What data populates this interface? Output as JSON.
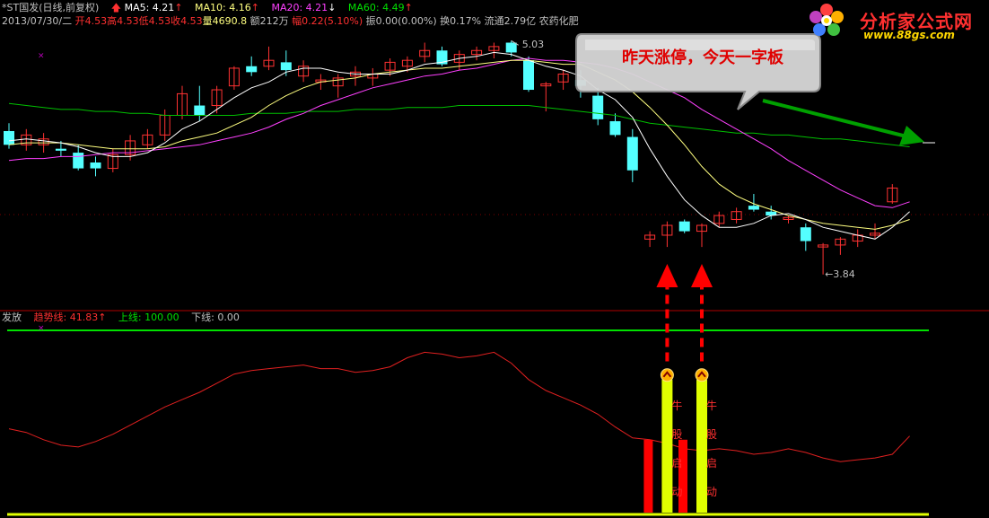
{
  "header": {
    "stock": "*ST国发(日线,前复权)",
    "ma5_label": "MA5: 4.21",
    "ma10_label": "MA10: 4.16",
    "ma20_label": "MA20: 4.21",
    "ma60_label": "MA60: 4.49",
    "date": "2013/07/30/二",
    "open": "开4.53",
    "high": "高4.53",
    "low": "低4.53",
    "close": "收4.53",
    "volume": "量4690.8",
    "amount": "额212万",
    "change": "幅0.22(5.10%)",
    "amplitude": "振0.00(0.00%)",
    "turnover": "换0.17%",
    "float": "流通2.79亿",
    "sector": "农药化肥"
  },
  "price_marks": {
    "high": "5.03",
    "low": "←3.84"
  },
  "callout": "昨天涨停，今天一字板",
  "logo": {
    "name": "分析家公式网",
    "url": "www.88gs.com"
  },
  "indicator": {
    "name": "发放",
    "trend_label": "趋势线: 41.83",
    "upper_label": "上线: 100.00",
    "lower_label": "下线: 0.00",
    "signal_text": [
      "牛",
      "股",
      "启",
      "动"
    ]
  },
  "colors": {
    "up": "#ff3232",
    "down": "#54ffff",
    "ma5": "#ffffff",
    "ma10": "#ffff80",
    "ma20": "#ff40ff",
    "ma60": "#00c000",
    "trend": "#e02020",
    "upper": "#00e000",
    "signal": "#e0ff00",
    "arrow": "#ff0000",
    "callout_arrow": "#00a000"
  },
  "chart_data": {
    "type": "candlestick",
    "ohlc": [
      [
        4.57,
        4.61,
        4.48,
        4.5
      ],
      [
        4.5,
        4.58,
        4.47,
        4.55
      ],
      [
        4.5,
        4.56,
        4.46,
        4.53
      ],
      [
        4.48,
        4.52,
        4.44,
        4.47
      ],
      [
        4.46,
        4.5,
        4.37,
        4.38
      ],
      [
        4.41,
        4.44,
        4.34,
        4.38
      ],
      [
        4.38,
        4.48,
        4.36,
        4.45
      ],
      [
        4.45,
        4.55,
        4.42,
        4.52
      ],
      [
        4.5,
        4.58,
        4.48,
        4.55
      ],
      [
        4.55,
        4.68,
        4.52,
        4.65
      ],
      [
        4.65,
        4.8,
        4.63,
        4.76
      ],
      [
        4.7,
        4.8,
        4.62,
        4.65
      ],
      [
        4.7,
        4.8,
        4.66,
        4.78
      ],
      [
        4.8,
        4.9,
        4.78,
        4.89
      ],
      [
        4.9,
        4.95,
        4.85,
        4.87
      ],
      [
        4.9,
        5.0,
        4.88,
        4.93
      ],
      [
        4.92,
        4.98,
        4.85,
        4.88
      ],
      [
        4.85,
        4.93,
        4.82,
        4.9
      ],
      [
        4.82,
        4.86,
        4.78,
        4.83
      ],
      [
        4.8,
        4.86,
        4.74,
        4.84
      ],
      [
        4.85,
        4.9,
        4.8,
        4.87
      ],
      [
        4.84,
        4.89,
        4.8,
        4.86
      ],
      [
        4.88,
        4.94,
        4.85,
        4.92
      ],
      [
        4.9,
        4.95,
        4.87,
        4.93
      ],
      [
        4.95,
        5.02,
        4.92,
        4.98
      ],
      [
        4.98,
        5.0,
        4.9,
        4.91
      ],
      [
        4.92,
        4.98,
        4.88,
        4.96
      ],
      [
        4.96,
        5.0,
        4.93,
        4.98
      ],
      [
        4.98,
        5.02,
        4.94,
        5.0
      ],
      [
        5.02,
        5.03,
        4.95,
        4.97
      ],
      [
        4.93,
        4.95,
        4.77,
        4.78
      ],
      [
        4.8,
        4.82,
        4.67,
        4.81
      ],
      [
        4.82,
        4.88,
        4.78,
        4.86
      ],
      [
        4.83,
        4.88,
        4.74,
        4.8
      ],
      [
        4.75,
        4.79,
        4.6,
        4.63
      ],
      [
        4.62,
        4.66,
        4.54,
        4.55
      ],
      [
        4.54,
        4.58,
        4.31,
        4.37
      ],
      [
        4.02,
        4.06,
        3.98,
        4.04
      ],
      [
        4.04,
        4.11,
        3.98,
        4.09
      ],
      [
        4.11,
        4.12,
        4.05,
        4.06
      ],
      [
        4.06,
        4.1,
        3.98,
        4.09
      ],
      [
        4.1,
        4.16,
        4.08,
        4.14
      ],
      [
        4.12,
        4.18,
        4.1,
        4.16
      ],
      [
        4.19,
        4.25,
        4.16,
        4.17
      ],
      [
        4.16,
        4.19,
        4.12,
        4.14
      ],
      [
        4.12,
        4.14,
        4.1,
        4.13
      ],
      [
        4.08,
        4.1,
        3.96,
        4.01
      ],
      [
        3.98,
        4.0,
        3.84,
        3.99
      ],
      [
        3.99,
        4.03,
        3.94,
        4.02
      ],
      [
        4.01,
        4.07,
        3.98,
        4.04
      ],
      [
        4.04,
        4.1,
        4.02,
        4.05
      ],
      [
        4.21,
        4.3,
        4.2,
        4.28
      ],
      [
        4.53,
        4.53,
        4.53,
        4.53
      ]
    ],
    "ma5": [
      4.52,
      4.53,
      4.52,
      4.51,
      4.49,
      4.46,
      4.44,
      4.44,
      4.46,
      4.51,
      4.58,
      4.62,
      4.68,
      4.74,
      4.79,
      4.82,
      4.87,
      4.89,
      4.89,
      4.87,
      4.86,
      4.86,
      4.86,
      4.88,
      4.91,
      4.92,
      4.94,
      4.95,
      4.97,
      4.96,
      4.93,
      4.9,
      4.88,
      4.85,
      4.78,
      4.73,
      4.64,
      4.48,
      4.34,
      4.22,
      4.14,
      4.08,
      4.08,
      4.1,
      4.14,
      4.15,
      4.12,
      4.08,
      4.06,
      4.04,
      4.02,
      4.08,
      4.16
    ],
    "ma10": [
      4.5,
      4.51,
      4.51,
      4.51,
      4.5,
      4.49,
      4.48,
      4.48,
      4.48,
      4.49,
      4.52,
      4.54,
      4.56,
      4.6,
      4.64,
      4.7,
      4.75,
      4.79,
      4.82,
      4.83,
      4.84,
      4.86,
      4.87,
      4.88,
      4.89,
      4.89,
      4.9,
      4.91,
      4.92,
      4.93,
      4.93,
      4.92,
      4.91,
      4.91,
      4.87,
      4.83,
      4.77,
      4.69,
      4.6,
      4.5,
      4.39,
      4.3,
      4.24,
      4.2,
      4.17,
      4.14,
      4.12,
      4.1,
      4.09,
      4.08,
      4.07,
      4.09,
      4.12
    ],
    "ma20": [
      4.42,
      4.43,
      4.43,
      4.44,
      4.44,
      4.45,
      4.46,
      4.46,
      4.47,
      4.48,
      4.49,
      4.5,
      4.52,
      4.54,
      4.56,
      4.59,
      4.63,
      4.66,
      4.7,
      4.73,
      4.76,
      4.79,
      4.81,
      4.83,
      4.85,
      4.86,
      4.88,
      4.89,
      4.91,
      4.93,
      4.94,
      4.93,
      4.93,
      4.92,
      4.91,
      4.89,
      4.86,
      4.82,
      4.78,
      4.74,
      4.68,
      4.63,
      4.58,
      4.53,
      4.48,
      4.42,
      4.37,
      4.32,
      4.27,
      4.23,
      4.19,
      4.18,
      4.21
    ],
    "ma60": [
      4.71,
      4.7,
      4.69,
      4.68,
      4.68,
      4.67,
      4.67,
      4.66,
      4.66,
      4.65,
      4.65,
      4.65,
      4.65,
      4.65,
      4.66,
      4.66,
      4.66,
      4.67,
      4.67,
      4.67,
      4.68,
      4.68,
      4.68,
      4.69,
      4.69,
      4.69,
      4.7,
      4.7,
      4.7,
      4.7,
      4.7,
      4.69,
      4.68,
      4.67,
      4.66,
      4.65,
      4.63,
      4.61,
      4.6,
      4.59,
      4.58,
      4.57,
      4.56,
      4.56,
      4.55,
      4.55,
      4.54,
      4.53,
      4.53,
      4.52,
      4.51,
      4.5,
      4.49
    ],
    "trend": [
      46,
      44,
      40,
      37,
      36,
      39,
      43,
      48,
      53,
      58,
      62,
      66,
      71,
      76,
      78,
      79,
      80,
      81,
      79,
      79,
      77,
      78,
      80,
      85,
      88,
      87,
      85,
      86,
      88,
      82,
      73,
      67,
      63,
      59,
      54,
      47,
      41,
      40,
      38,
      35,
      34,
      35,
      34,
      32,
      33,
      35,
      33,
      30,
      28,
      29,
      30,
      32,
      42
    ],
    "signal_days": [
      38,
      40
    ],
    "upper": 100,
    "lower": 0,
    "price_range": [
      3.72,
      5.1
    ]
  }
}
